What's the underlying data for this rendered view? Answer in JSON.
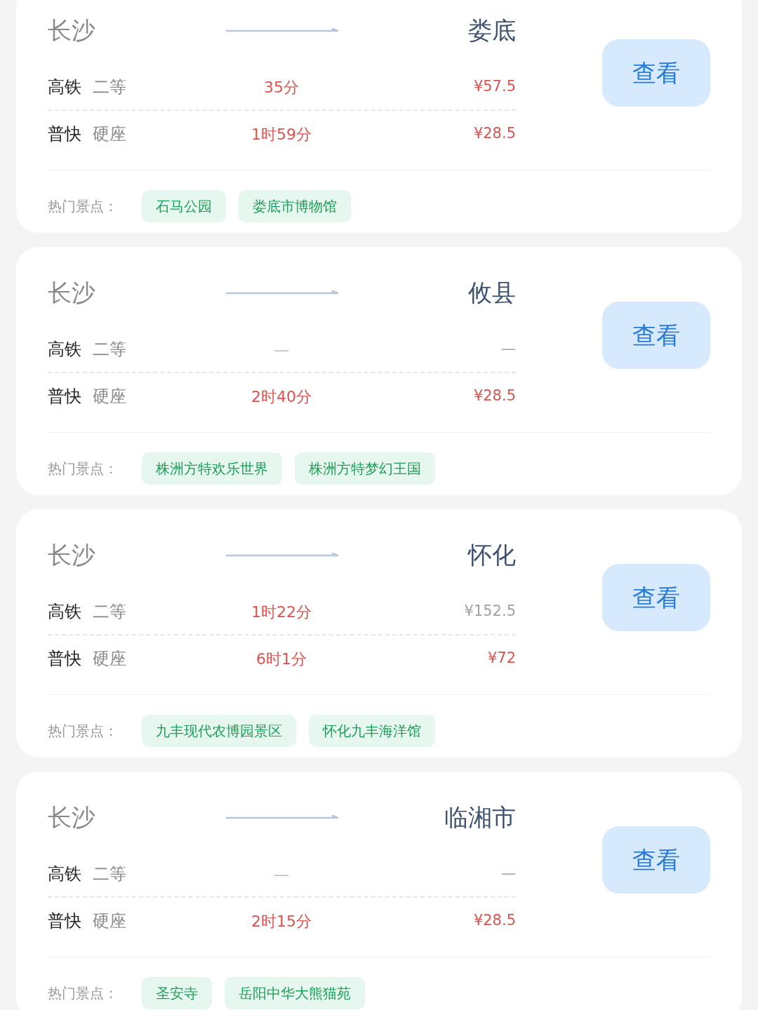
{
  "routes": [
    {
      "from": "长沙",
      "to": "娄底",
      "trains": [
        {
          "type": "高铁",
          "seat": "二等",
          "duration": "35分",
          "price": "¥57.5",
          "price_muted": false
        },
        {
          "type": "普快",
          "seat": "硬座",
          "duration": "1时59分",
          "price": "¥28.5",
          "price_muted": false
        }
      ],
      "button": "查看",
      "attractions_label": "热门景点：",
      "attractions": [
        "石马公园",
        "娄底市博物馆"
      ]
    },
    {
      "from": "长沙",
      "to": "攸县",
      "trains": [
        {
          "type": "高铁",
          "seat": "二等",
          "duration": "—",
          "price": "—",
          "price_muted": true
        },
        {
          "type": "普快",
          "seat": "硬座",
          "duration": "2时40分",
          "price": "¥28.5",
          "price_muted": false
        }
      ],
      "button": "查看",
      "attractions_label": "热门景点：",
      "attractions": [
        "株洲方特欢乐世界",
        "株洲方特梦幻王国"
      ]
    },
    {
      "from": "长沙",
      "to": "怀化",
      "trains": [
        {
          "type": "高铁",
          "seat": "二等",
          "duration": "1时22分",
          "price": "¥152.5",
          "price_muted": true
        },
        {
          "type": "普快",
          "seat": "硬座",
          "duration": "6时1分",
          "price": "¥72",
          "price_muted": false
        }
      ],
      "button": "查看",
      "attractions_label": "热门景点：",
      "attractions": [
        "九丰现代农博园景区",
        "怀化九丰海洋馆"
      ]
    },
    {
      "from": "长沙",
      "to": "临湘市",
      "trains": [
        {
          "type": "高铁",
          "seat": "二等",
          "duration": "—",
          "price": "—",
          "price_muted": true
        },
        {
          "type": "普快",
          "seat": "硬座",
          "duration": "2时15分",
          "price": "¥28.5",
          "price_muted": false
        }
      ],
      "button": "查看",
      "attractions_label": "热门景点：",
      "attractions": [
        "圣安寺",
        "岳阳中华大熊猫苑"
      ]
    }
  ]
}
